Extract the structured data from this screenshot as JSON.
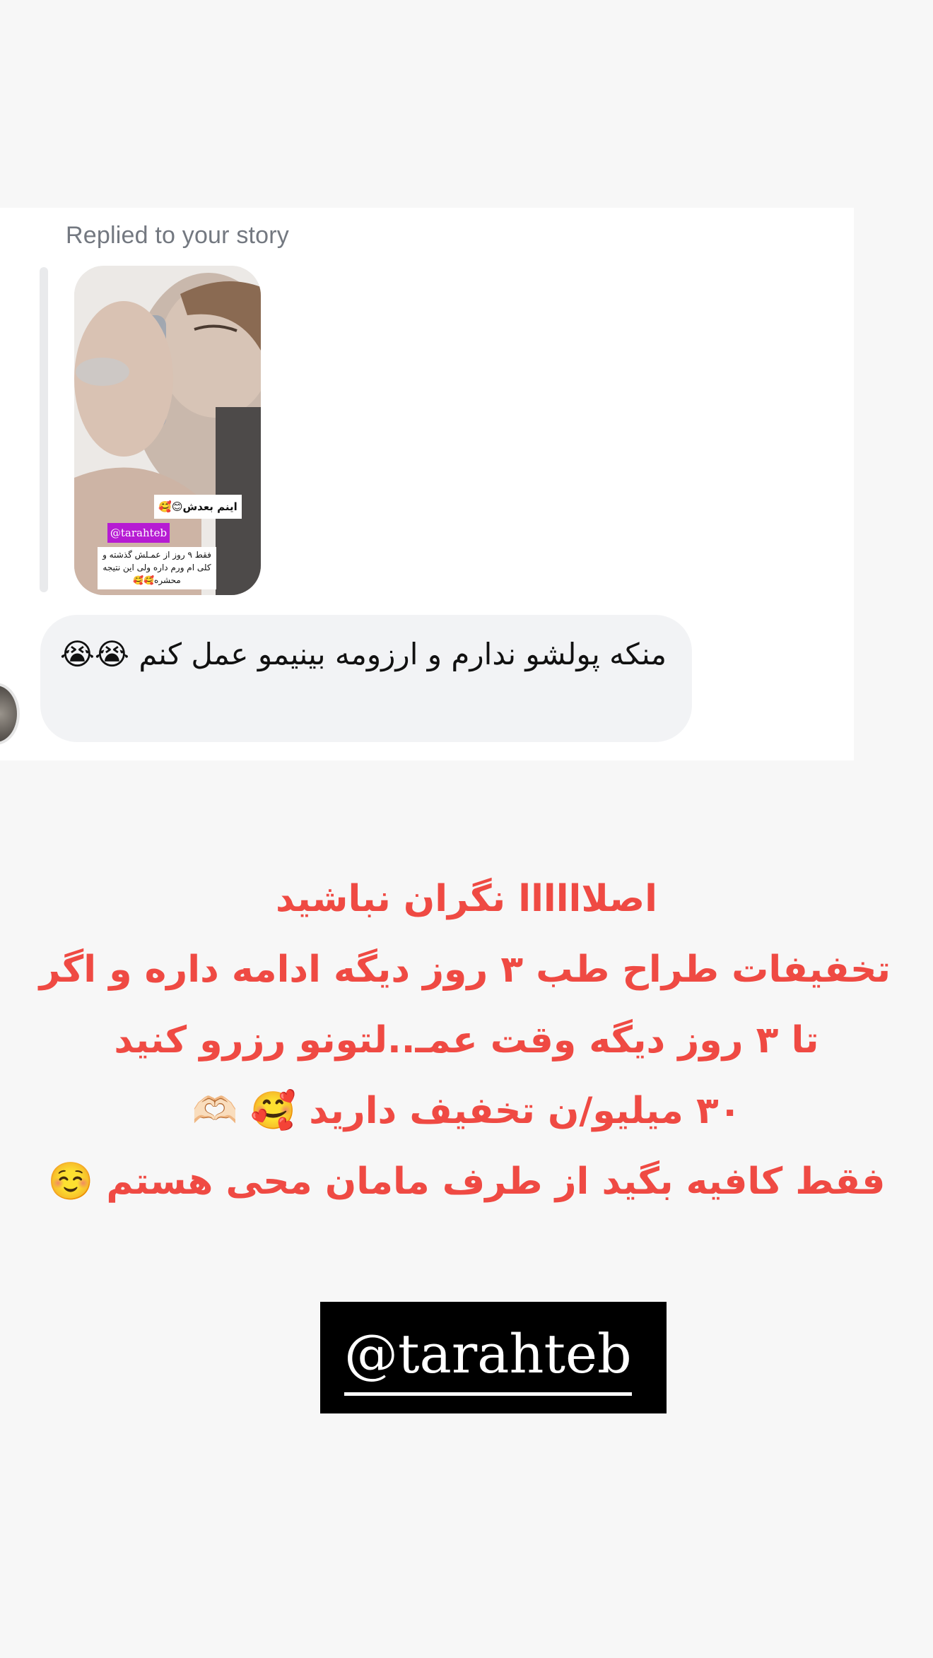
{
  "dm": {
    "replied_label": "Replied to your story",
    "story": {
      "sticker_top": "اینم بعدش😊🥰",
      "sticker_tag": "@tarahteb",
      "sticker_bottom": "فقط ۹ روز از عمـلش گذشته و کلی ام ورم داره ولی این نتیجه محشره🥰🥰"
    },
    "message": "منکه پولشو ندارم و ارزومه بینیمو عمل کنم 😭😭"
  },
  "promo": {
    "lines": [
      "اصلاااااا نگران نباشید",
      "تخفیفات طراح طب ۳ روز دیگه ادامه داره و اگر",
      "تا ۳ روز دیگه وقت عمـ..لتونو رزرو کنید",
      "۳۰ میلیو/ن تخفیف دارید 🥰 🫶🏻",
      "فقط کافیه بگید از طرف مامان محی هستم ☺️"
    ],
    "color": "#ef4a43"
  },
  "handle": {
    "text": "@tarahteb"
  }
}
